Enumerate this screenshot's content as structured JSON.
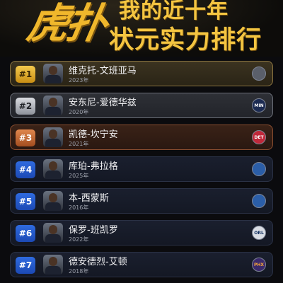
{
  "header": {
    "logo_text": "虎扑",
    "title_line1": "我的近十年",
    "title_line2": "状元实力排行"
  },
  "rows": [
    {
      "rank": "#1",
      "name": "维克托-文班亚马",
      "year": "2023年",
      "team_icon": "spurs-logo-icon",
      "team_abbr": ""
    },
    {
      "rank": "#2",
      "name": "安东尼-爱德华兹",
      "year": "2020年",
      "team_icon": "timberwolves-logo-icon",
      "team_abbr": "MIN"
    },
    {
      "rank": "#3",
      "name": "凯德-坎宁安",
      "year": "2021年",
      "team_icon": "pistons-logo-icon",
      "team_abbr": "DET"
    },
    {
      "rank": "#4",
      "name": "库珀-弗拉格",
      "year": "2025年",
      "team_icon": "mavericks-logo-icon",
      "team_abbr": ""
    },
    {
      "rank": "#5",
      "name": "本-西蒙斯",
      "year": "2016年",
      "team_icon": "76ers-logo-icon",
      "team_abbr": ""
    },
    {
      "rank": "#6",
      "name": "保罗-班凯罗",
      "year": "2022年",
      "team_icon": "magic-logo-icon",
      "team_abbr": "ORL"
    },
    {
      "rank": "#7",
      "name": "德安德烈-艾顿",
      "year": "2018年",
      "team_icon": "suns-logo-icon",
      "team_abbr": "PHX"
    }
  ]
}
